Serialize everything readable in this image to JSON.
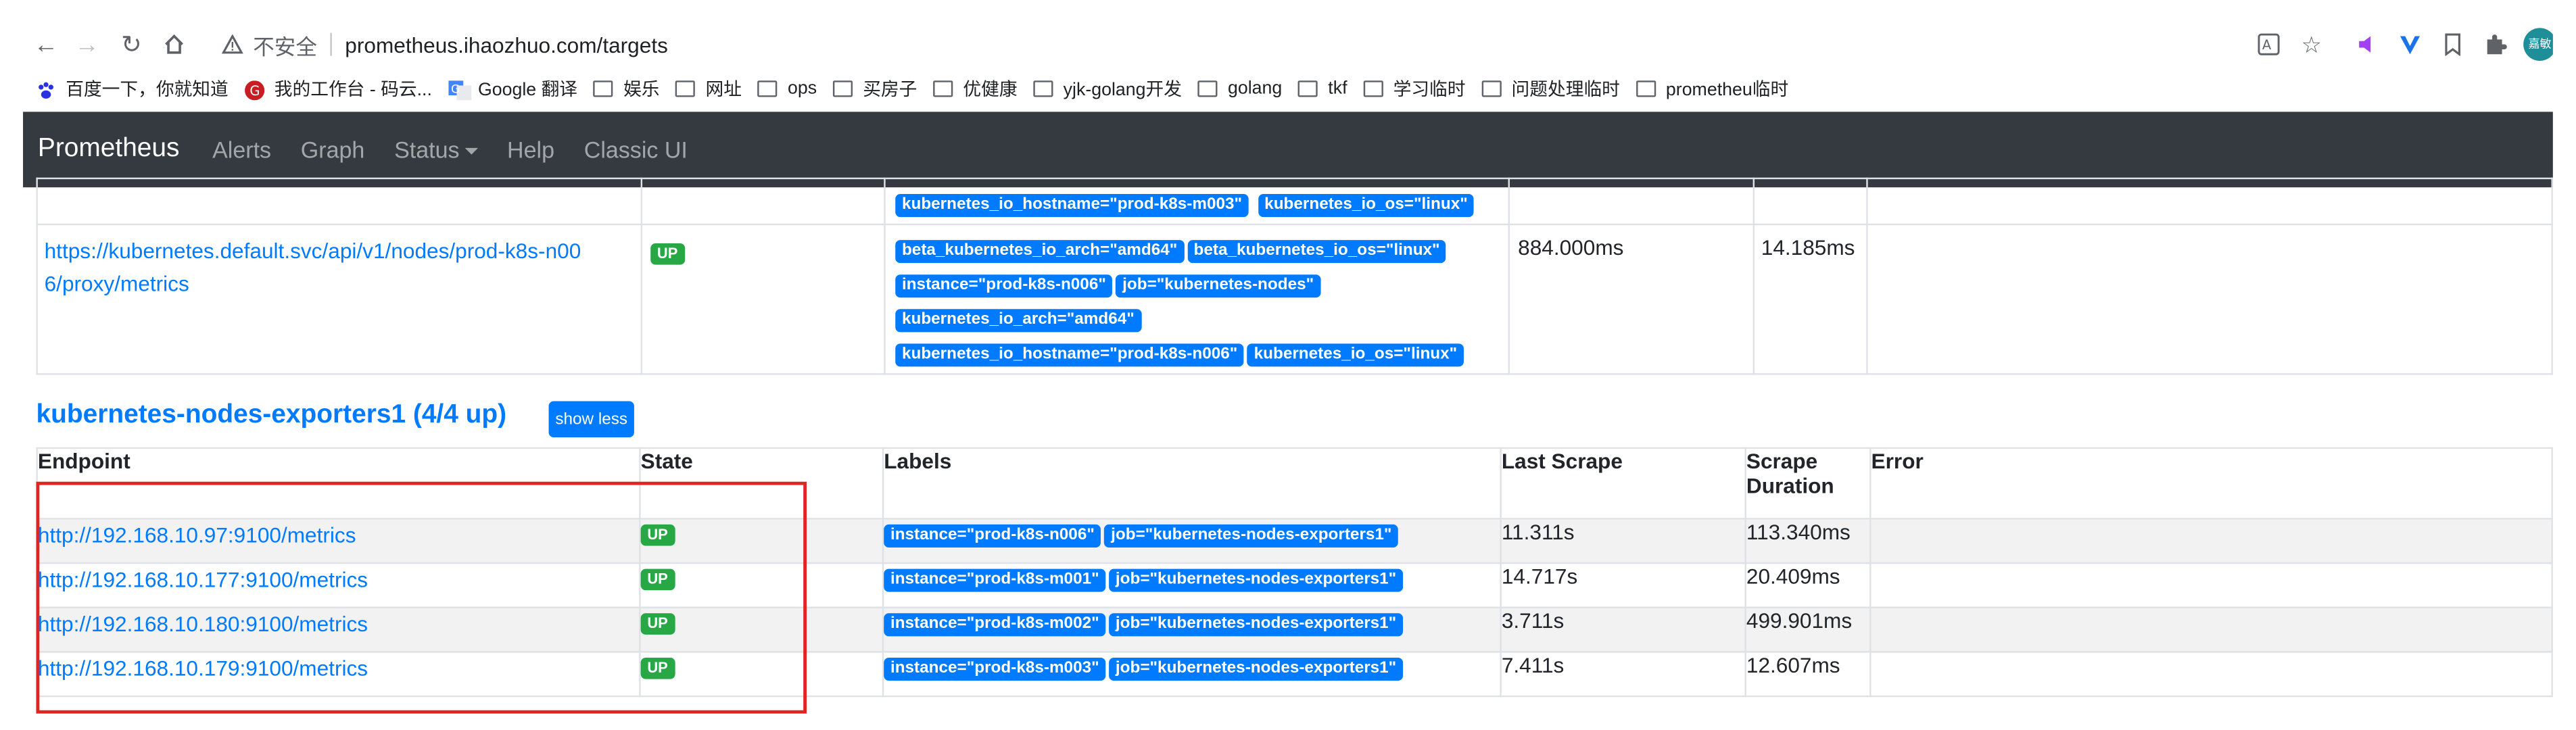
{
  "browser": {
    "insecure_label": "不安全",
    "url": "prometheus.ihaozhuo.com/targets",
    "avatar_text": "嘉敏"
  },
  "bookmarks": [
    {
      "label": "百度一下，你就知道",
      "icon": "paw-icon"
    },
    {
      "label": "我的工作台 - 码云...",
      "icon": "gitee-icon"
    },
    {
      "label": "Google 翻译",
      "icon": "translate-icon"
    },
    {
      "label": "娱乐",
      "icon": "folder-icon"
    },
    {
      "label": "网址",
      "icon": "folder-icon"
    },
    {
      "label": "ops",
      "icon": "folder-icon"
    },
    {
      "label": "买房子",
      "icon": "folder-icon"
    },
    {
      "label": "优健康",
      "icon": "folder-icon"
    },
    {
      "label": "yjk-golang开发",
      "icon": "folder-icon"
    },
    {
      "label": "golang",
      "icon": "folder-icon"
    },
    {
      "label": "tkf",
      "icon": "folder-icon"
    },
    {
      "label": "学习临时",
      "icon": "folder-icon"
    },
    {
      "label": "问题处理临时",
      "icon": "folder-icon"
    },
    {
      "label": "prometheu临时",
      "icon": "folder-icon"
    }
  ],
  "navbar": {
    "brand": "Prometheus",
    "links": [
      "Alerts",
      "Graph",
      "Status",
      "Help",
      "Classic UI"
    ]
  },
  "prev_pool": {
    "top_labels": [
      "kubernetes_io_hostname=\"prod-k8s-m003\"",
      "kubernetes_io_os=\"linux\""
    ],
    "row": {
      "endpoint_line1": "https://kubernetes.default.svc/api/v1/nodes/prod-k8s-n00",
      "endpoint_line2": "6/proxy/metrics",
      "state": "UP",
      "labels": [
        "beta_kubernetes_io_arch=\"amd64\"",
        "beta_kubernetes_io_os=\"linux\"",
        "instance=\"prod-k8s-n006\"",
        "job=\"kubernetes-nodes\"",
        "kubernetes_io_arch=\"amd64\"",
        "kubernetes_io_hostname=\"prod-k8s-n006\"",
        "kubernetes_io_os=\"linux\""
      ],
      "last_scrape": "884.000ms",
      "scrape_duration": "14.185ms"
    }
  },
  "pool": {
    "title": "kubernetes-nodes-exporters1 (4/4 up)",
    "show_less": "show less",
    "headers": {
      "endpoint": "Endpoint",
      "state": "State",
      "labels": "Labels",
      "last_scrape": "Last Scrape",
      "scrape_duration_1": "Scrape",
      "scrape_duration_2": "Duration",
      "error": "Error"
    },
    "rows": [
      {
        "endpoint": "http://192.168.10.97:9100/metrics",
        "state": "UP",
        "instance": "instance=\"prod-k8s-n006\"",
        "job": "job=\"kubernetes-nodes-exporters1\"",
        "last_scrape": "11.311s",
        "duration": "113.340ms",
        "error": ""
      },
      {
        "endpoint": "http://192.168.10.177:9100/metrics",
        "state": "UP",
        "instance": "instance=\"prod-k8s-m001\"",
        "job": "job=\"kubernetes-nodes-exporters1\"",
        "last_scrape": "14.717s",
        "duration": "20.409ms",
        "error": ""
      },
      {
        "endpoint": "http://192.168.10.180:9100/metrics",
        "state": "UP",
        "instance": "instance=\"prod-k8s-m002\"",
        "job": "job=\"kubernetes-nodes-exporters1\"",
        "last_scrape": "3.711s",
        "duration": "499.901ms",
        "error": ""
      },
      {
        "endpoint": "http://192.168.10.179:9100/metrics",
        "state": "UP",
        "instance": "instance=\"prod-k8s-m003\"",
        "job": "job=\"kubernetes-nodes-exporters1\"",
        "last_scrape": "7.411s",
        "duration": "12.607ms",
        "error": ""
      }
    ]
  },
  "colors": {
    "navbar_bg": "#343a40",
    "link": "#007bff",
    "badge_up": "#28a745",
    "highlight_box": "#e02424"
  }
}
